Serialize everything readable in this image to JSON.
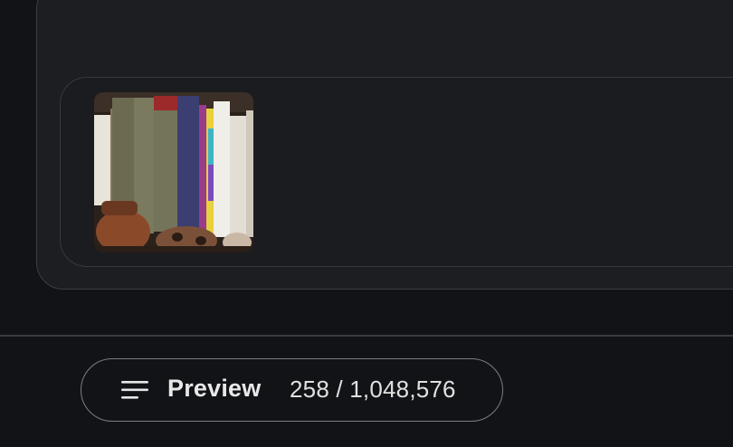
{
  "attachment": {
    "thumbnail_icon": "bookshelf-image-thumbnail"
  },
  "footer": {
    "menu_icon": "menu-icon",
    "preview_label": "Preview",
    "token_count": "258 / 1,048,576"
  }
}
